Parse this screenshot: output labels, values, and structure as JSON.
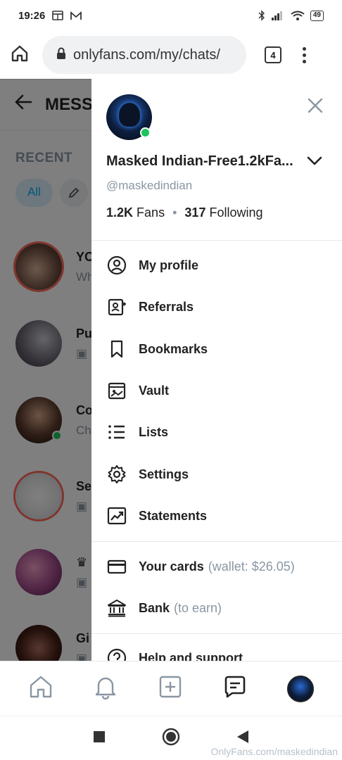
{
  "statusbar": {
    "time": "19:26",
    "battery": "49"
  },
  "browser": {
    "url": "onlyfans.com/my/chats/",
    "tab_count": "4"
  },
  "background": {
    "header_title": "MESS",
    "recent_label": "RECENT",
    "filter_all": "All",
    "chats": [
      {
        "name": "YO",
        "sub": "Wh"
      },
      {
        "name": "Pu",
        "sub": ""
      },
      {
        "name": "Co",
        "sub": "Ch"
      },
      {
        "name": "Se",
        "sub": ""
      },
      {
        "name": "",
        "sub": ""
      },
      {
        "name": "Gi",
        "sub": ""
      }
    ]
  },
  "drawer": {
    "name": "Masked Indian-Free1.2kFa...",
    "handle": "@maskedindian",
    "fans_count": "1.2K",
    "fans_label": "Fans",
    "following_count": "317",
    "following_label": "Following",
    "menu": [
      {
        "label": "My profile",
        "icon": "user-circle-icon"
      },
      {
        "label": "Referrals",
        "icon": "referral-icon"
      },
      {
        "label": "Bookmarks",
        "icon": "bookmark-icon"
      },
      {
        "label": "Vault",
        "icon": "vault-icon"
      },
      {
        "label": "Lists",
        "icon": "list-icon"
      },
      {
        "label": "Settings",
        "icon": "gear-icon"
      },
      {
        "label": "Statements",
        "icon": "chart-icon"
      }
    ],
    "cards_label": "Your cards",
    "cards_extra": "(wallet: $26.05)",
    "bank_label": "Bank",
    "bank_extra": "(to earn)",
    "help_label": "Help and support"
  },
  "watermark": "OnlyFans.com/maskedindian",
  "colors": {
    "accent": "#00aff0",
    "online": "#1bc45c",
    "muted": "#8a96a3"
  }
}
